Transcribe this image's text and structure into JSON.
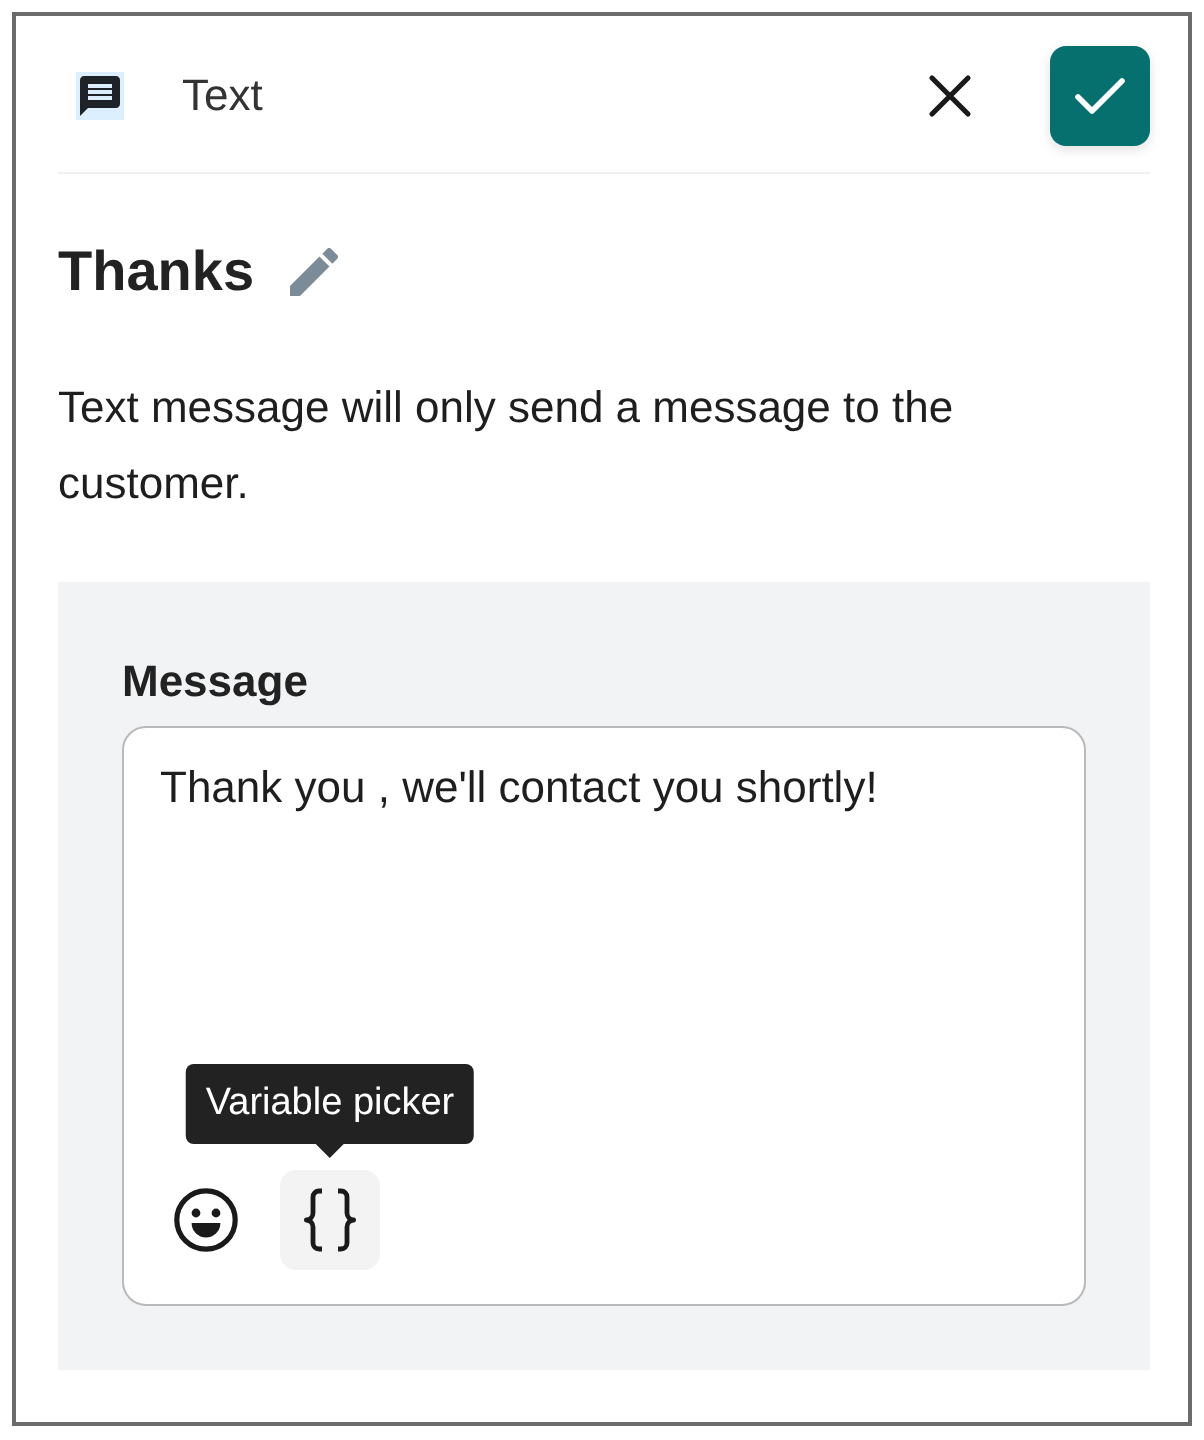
{
  "header": {
    "title": "Text"
  },
  "step": {
    "name": "Thanks",
    "description": "Text message will only send a message to the customer."
  },
  "message": {
    "label": "Message",
    "value": "Thank you , we'll contact you shortly!"
  },
  "tools": [
    {
      "kind": "emoji"
    },
    {
      "kind": "variables",
      "tooltip": "Variable picker"
    }
  ]
}
